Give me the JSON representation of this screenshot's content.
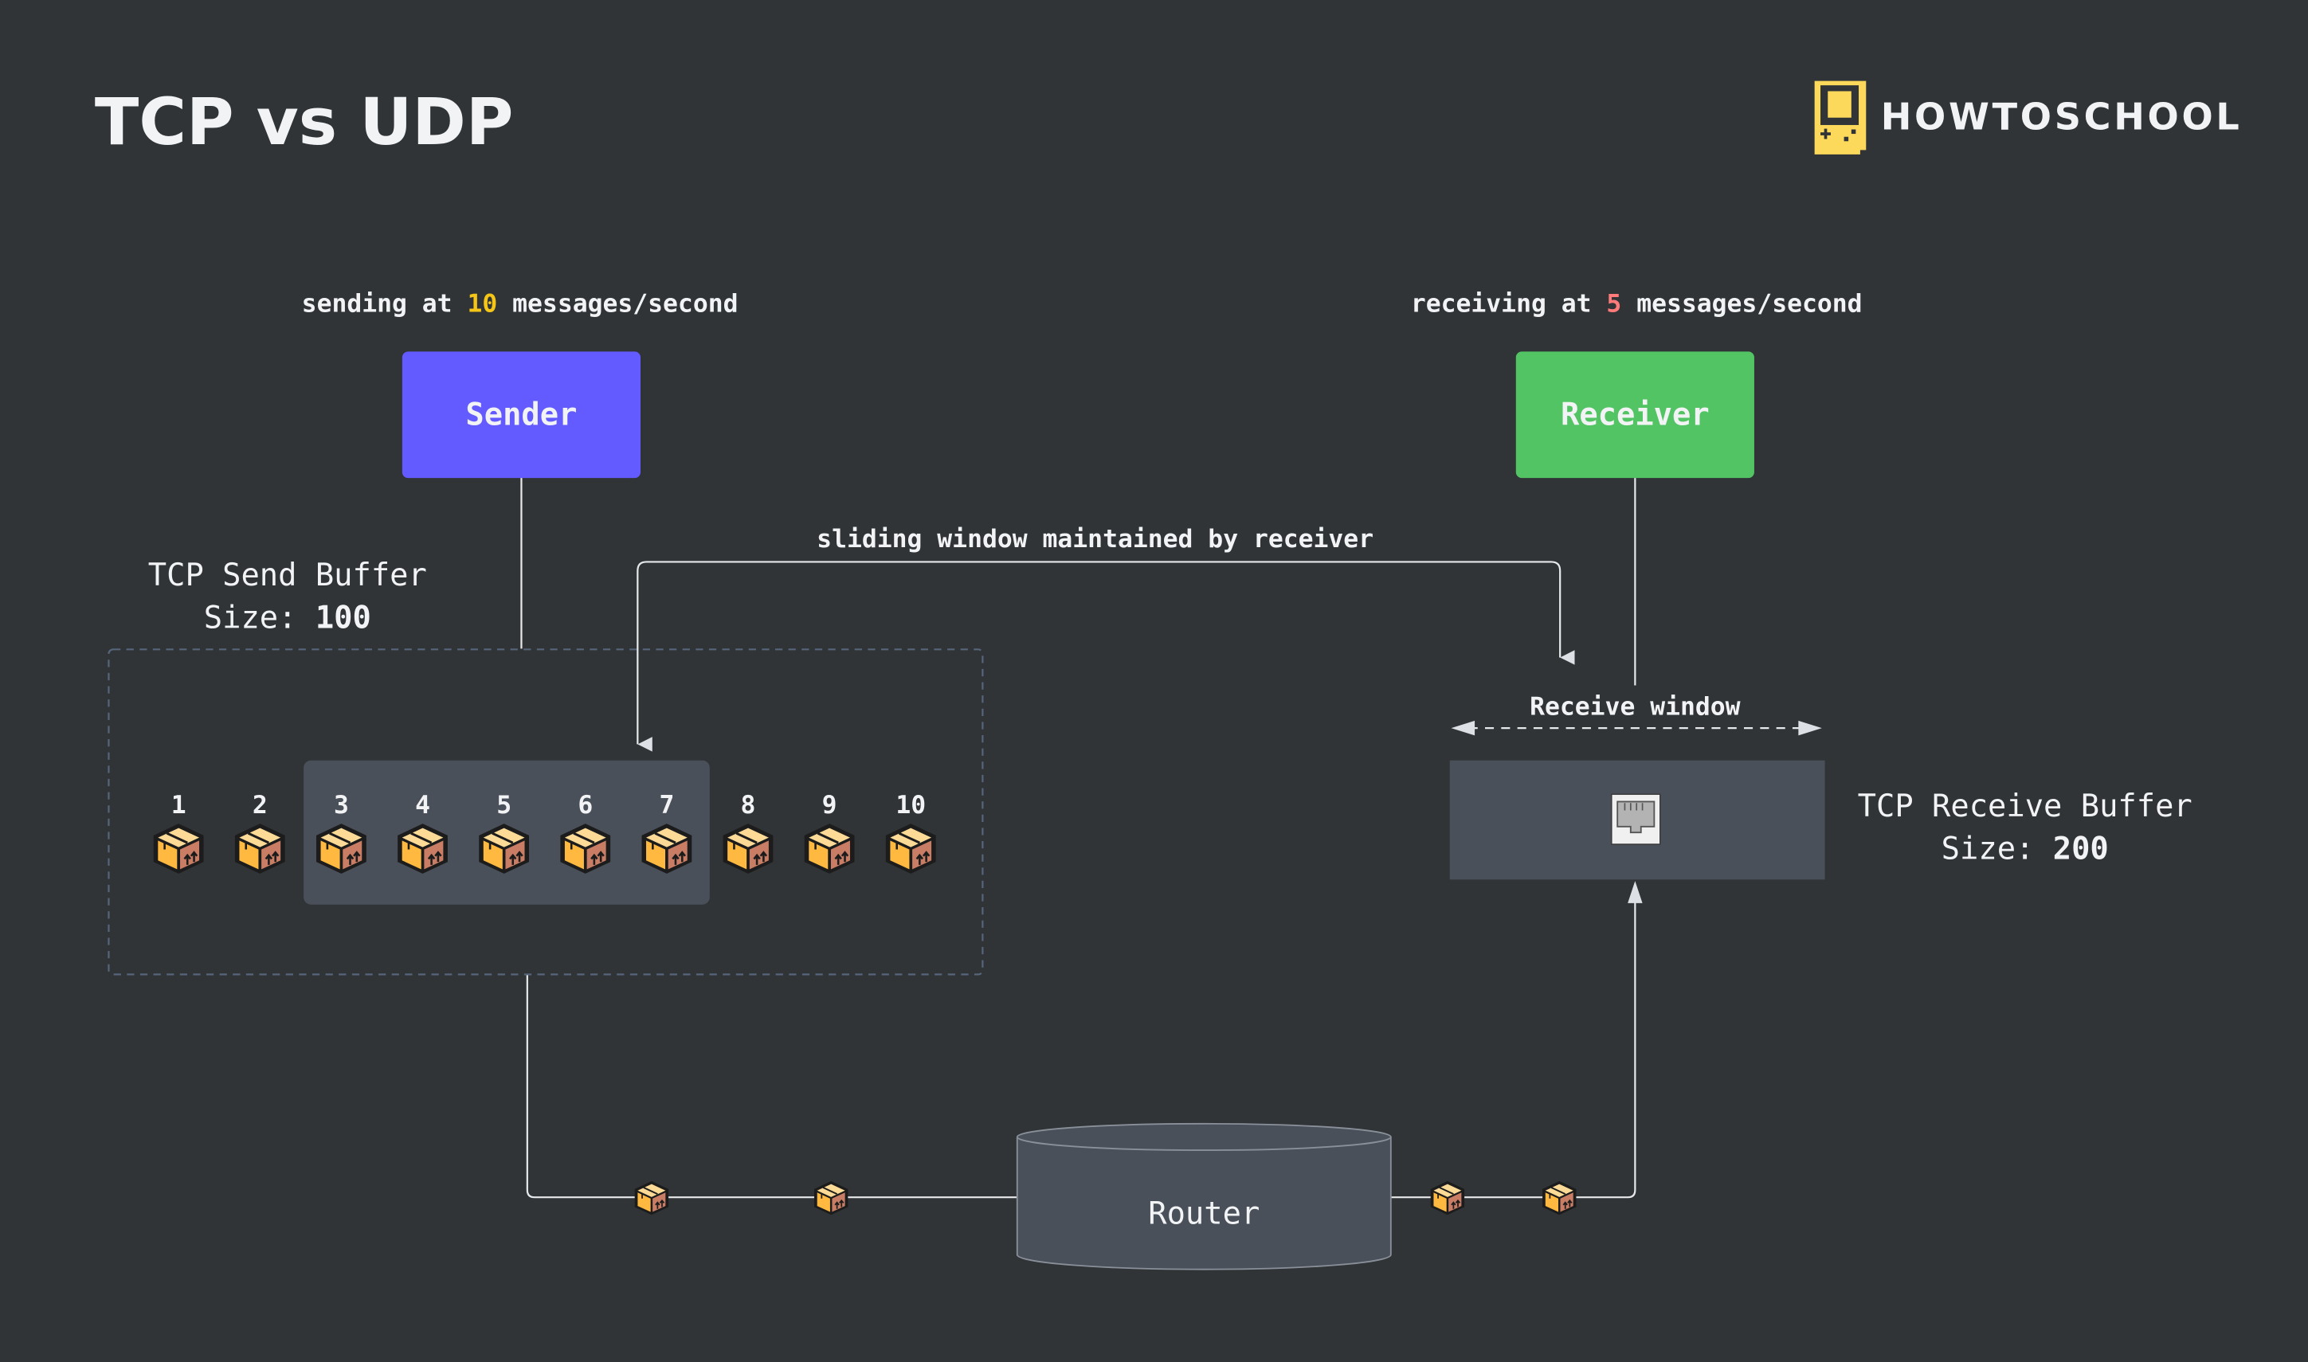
{
  "header": {
    "title": "TCP vs UDP",
    "logo_text": "HOWTOSCHOOL"
  },
  "sender": {
    "rate_prefix": "sending at ",
    "rate_value": "10",
    "rate_suffix": " messages/second",
    "label": "Sender",
    "color": "#635bff",
    "rate_color": "#f5c518"
  },
  "receiver": {
    "rate_prefix": "receiving at ",
    "rate_value": "5",
    "rate_suffix": " messages/second",
    "label": "Receiver",
    "color": "#52c463",
    "rate_color": "#ff7b7b"
  },
  "send_buffer": {
    "title": "TCP Send Buffer",
    "size_label": "Size: ",
    "size_value": "100",
    "packets": [
      "1",
      "2",
      "3",
      "4",
      "5",
      "6",
      "7",
      "8",
      "9",
      "10"
    ],
    "window_range": [
      3,
      7
    ]
  },
  "sliding_window_label": "sliding window maintained by receiver",
  "receive_buffer": {
    "title": "TCP Receive Buffer",
    "size_label": "Size: ",
    "size_value": "200",
    "window_label": "Receive window",
    "icon": "ethernet-port-icon"
  },
  "router": {
    "label": "Router"
  },
  "icons": {
    "packet": "package-box-icon",
    "logo": "gameboy-icon"
  },
  "colors": {
    "background": "#303437",
    "panel": "#4a505a",
    "line": "#e6e8ea",
    "dashed_border": "#56657a"
  }
}
